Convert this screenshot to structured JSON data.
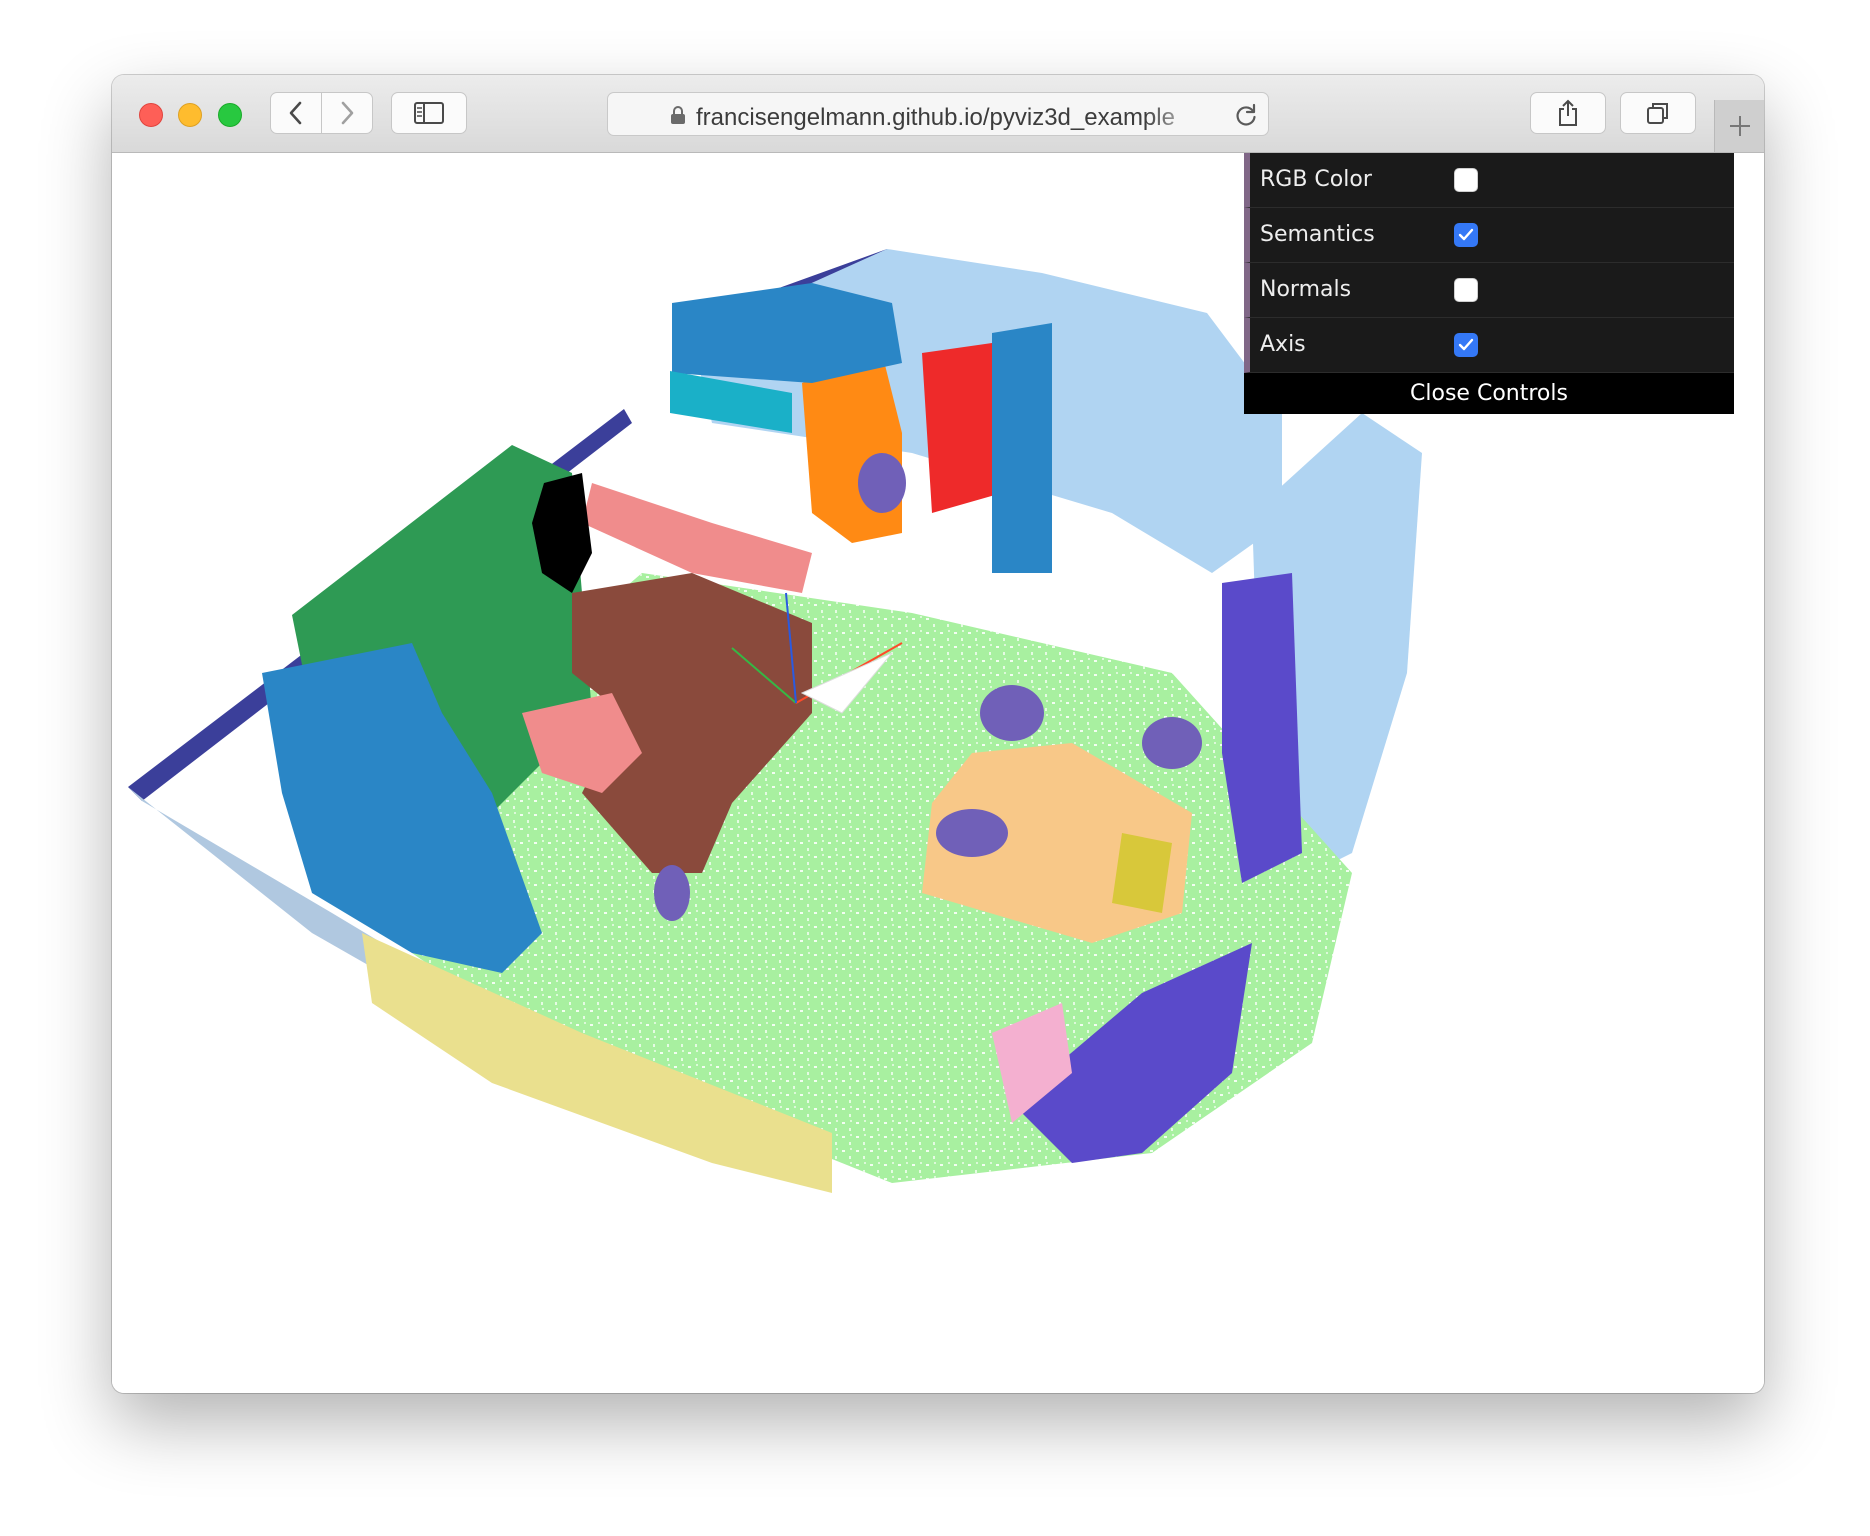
{
  "browser": {
    "url": "francisengelmann.github.io/pyviz3d_example"
  },
  "controls": {
    "items": [
      {
        "label": "RGB Color",
        "checked": false
      },
      {
        "label": "Semantics",
        "checked": true
      },
      {
        "label": "Normals",
        "checked": false
      },
      {
        "label": "Axis",
        "checked": true
      }
    ],
    "close_label": "Close Controls"
  },
  "colors": {
    "gui_background": "#1a1a1a",
    "gui_row_accent": "#806787",
    "checkbox_on": "#3478f6",
    "floor": "#a8f0a0",
    "wall": "#b0d4f2",
    "cabinet": "#2a86c6",
    "sofa": "#8a4a3c",
    "bed": "#f8c888",
    "chair": "#7060b8",
    "table": "#f08c8c",
    "door": "#ee2a2a",
    "bookshelf": "#ff8a14",
    "picture": "#1ab0c8",
    "window": "#2e9a54",
    "curtain": "#eae08e",
    "counter": "#5a4aca"
  }
}
